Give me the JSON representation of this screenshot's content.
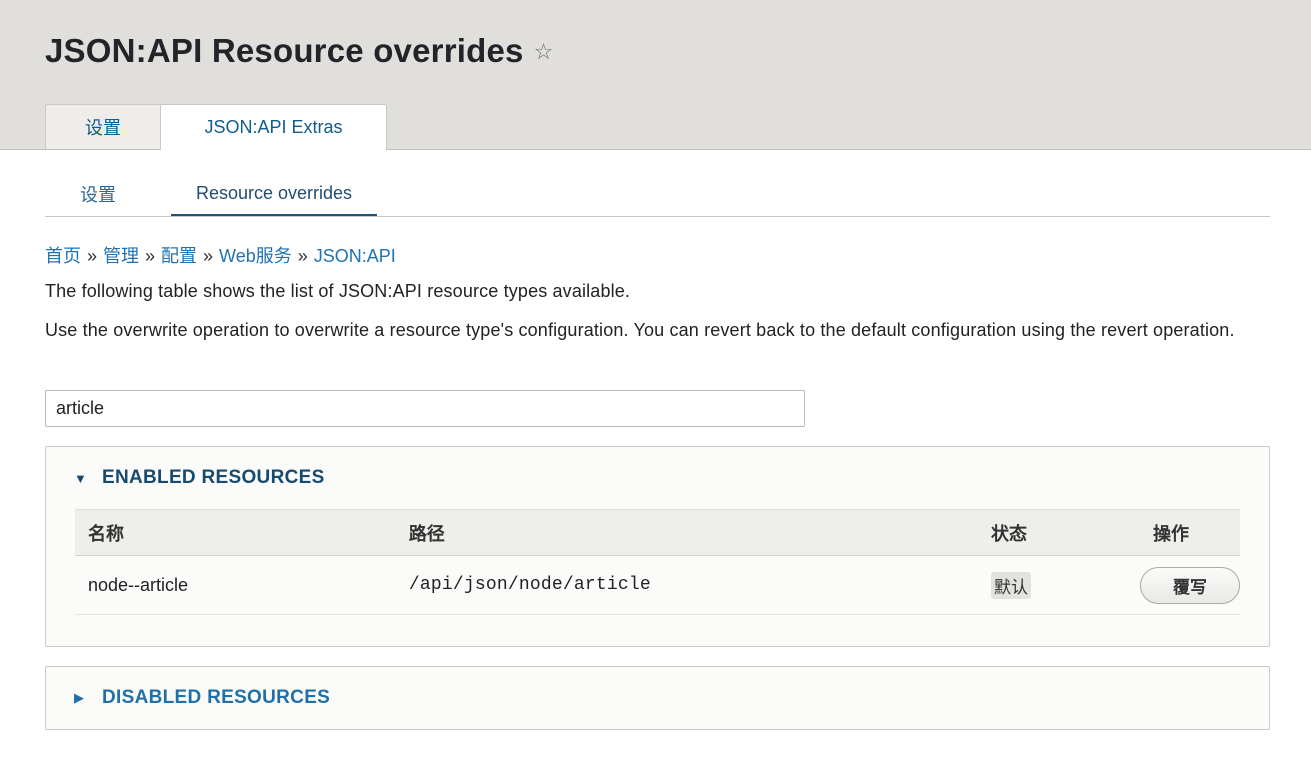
{
  "page": {
    "title": "JSON:API Resource overrides",
    "star_glyph": "☆"
  },
  "primary_tabs": [
    {
      "label": "设置",
      "active": false
    },
    {
      "label": "JSON:API Extras",
      "active": true
    }
  ],
  "secondary_tabs": [
    {
      "label": "设置",
      "active": false
    },
    {
      "label": "Resource overrides",
      "active": true
    }
  ],
  "breadcrumb": {
    "items": [
      "首页",
      "管理",
      "配置",
      "Web服务",
      "JSON:API"
    ],
    "separator": "»"
  },
  "description": {
    "line1": "The following table shows the list of JSON:API resource types available.",
    "line2": "Use the overwrite operation to overwrite a resource type's configuration. You can revert back to the default configuration using the revert operation."
  },
  "filter": {
    "value": "article"
  },
  "enabled_section": {
    "title": "ENABLED RESOURCES",
    "expanded": true,
    "columns": [
      "名称",
      "路径",
      "状态",
      "操作"
    ],
    "rows": [
      {
        "name": "node--article",
        "path": "/api/json/node/article",
        "status": "默认",
        "operation": "覆写"
      }
    ]
  },
  "disabled_section": {
    "title": "DISABLED RESOURCES",
    "expanded": false
  },
  "colors": {
    "header_bg": "#e0dfdb",
    "link": "#1f72b4",
    "summary_text": "#164a6e"
  },
  "icons": {
    "favorite": "star-outline-icon",
    "expanded": "triangle-down-icon",
    "collapsed": "triangle-right-icon"
  }
}
